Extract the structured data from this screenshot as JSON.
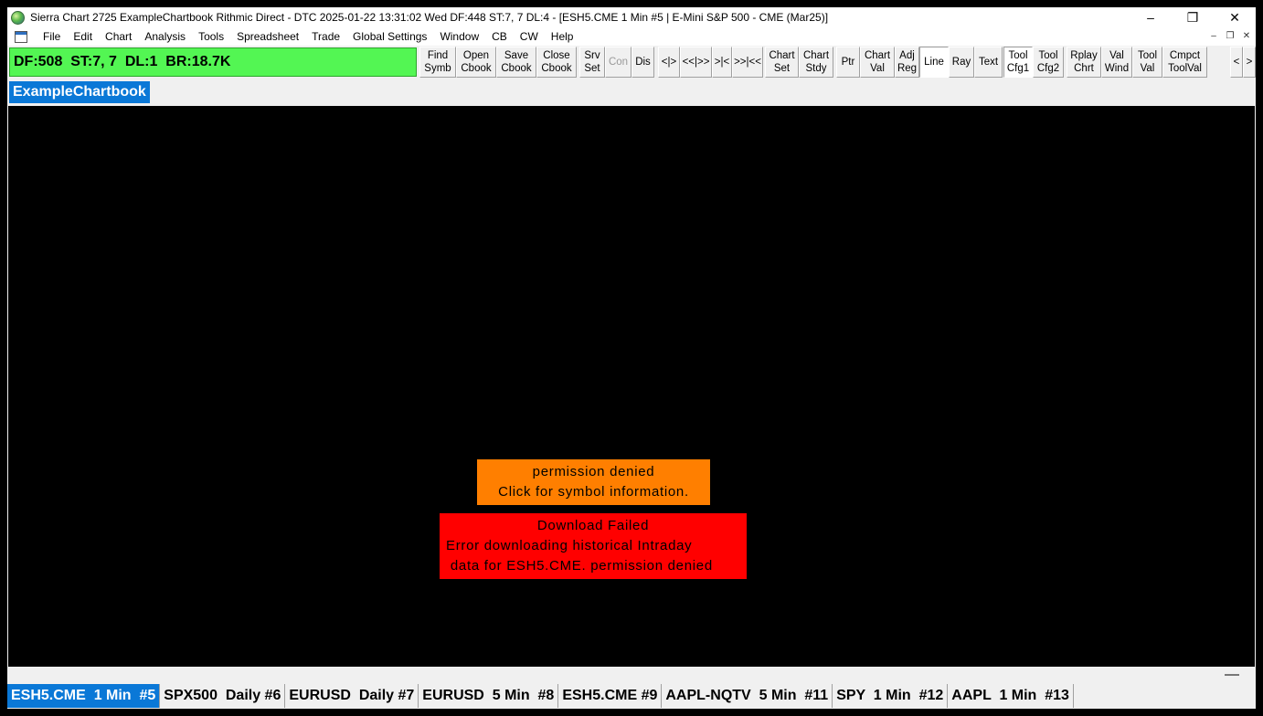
{
  "window": {
    "title": "Sierra Chart 2725 ExampleChartbook Rithmic Direct - DTC 2025-01-22  13:31:02 Wed DF:448  ST:7, 7  DL:4 - [ESH5.CME  1 Min  #5 | E-Mini S&P 500 - CME (Mar25)]",
    "controls": {
      "minimize": "–",
      "restore": "❐",
      "close": "✕"
    }
  },
  "menu": {
    "items": [
      "File",
      "Edit",
      "Chart",
      "Analysis",
      "Tools",
      "Spreadsheet",
      "Trade",
      "Global Settings",
      "Window",
      "CB",
      "CW",
      "Help"
    ],
    "mdi_controls": {
      "minimize": "–",
      "restore": "❐",
      "close": "✕"
    }
  },
  "status_box": {
    "text": "DF:508  ST:7, 7  DL:1  BR:18.7K",
    "color": "#53f653"
  },
  "toolbar": {
    "buttons": [
      {
        "label": "Find\nSymb"
      },
      {
        "label": "Open\nCbook"
      },
      {
        "label": "Save\nCbook"
      },
      {
        "label": "Close\nCbook"
      },
      {
        "label": "Srv\nSet"
      },
      {
        "label": "Con",
        "disabled": true
      },
      {
        "label": "Dis"
      },
      {
        "label": "<|>"
      },
      {
        "label": "<<|>>"
      },
      {
        "label": ">|<"
      },
      {
        "label": ">>|<<"
      },
      {
        "label": "Chart\nSet"
      },
      {
        "label": "Chart\nStdy"
      },
      {
        "label": "Ptr"
      },
      {
        "label": "Chart\nVal"
      },
      {
        "label": "Adj\nReg"
      },
      {
        "label": "Line",
        "pressed": true
      },
      {
        "label": "Ray"
      },
      {
        "label": "Text"
      },
      {
        "label": "Tool\nCfg1",
        "pressed": true
      },
      {
        "label": "Tool\nCfg2"
      },
      {
        "label": "Rplay\nChrt"
      },
      {
        "label": "Val\nWind"
      },
      {
        "label": "Tool\nVal"
      },
      {
        "label": "Cmpct\nToolVal"
      },
      {
        "label": "<"
      },
      {
        "label": ">"
      }
    ]
  },
  "chartbook": {
    "tab_label": "ExampleChartbook",
    "accent_color": "#0a78d7"
  },
  "messages": {
    "permission": {
      "line1": "permission denied",
      "line2": "Click for symbol information.",
      "color": "#ff7f00"
    },
    "download": {
      "line1": "Download Failed",
      "line2": "Error downloading historical Intraday",
      "line3": " data for ESH5.CME. permission denied",
      "color": "#ff0000"
    }
  },
  "chart_tabs": [
    {
      "label": "ESH5.CME  1 Min  #5",
      "active": true
    },
    {
      "label": "SPX500  Daily #6"
    },
    {
      "label": "EURUSD  Daily #7"
    },
    {
      "label": "EURUSD  5 Min  #8"
    },
    {
      "label": "ESH5.CME #9"
    },
    {
      "label": "AAPL-NQTV  5 Min  #11"
    },
    {
      "label": "SPY  1 Min  #12"
    },
    {
      "label": "AAPL  1 Min  #13"
    }
  ]
}
